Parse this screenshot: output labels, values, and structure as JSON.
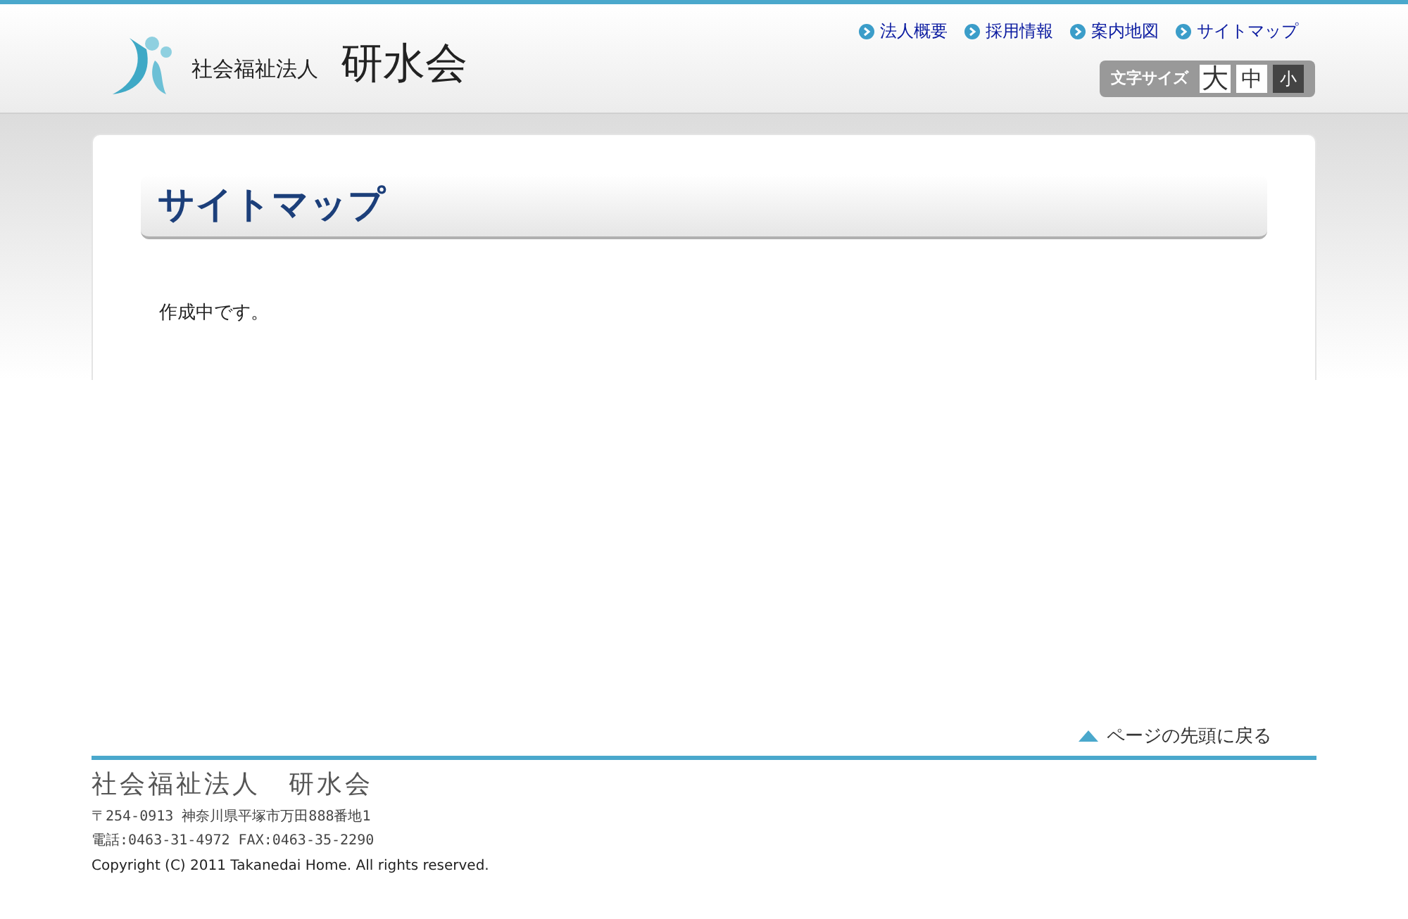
{
  "logo": {
    "subtitle": "社会福祉法人",
    "name": "研水会"
  },
  "nav": [
    {
      "label": "法人概要"
    },
    {
      "label": "採用情報"
    },
    {
      "label": "案内地図"
    },
    {
      "label": "サイトマップ"
    }
  ],
  "font_size": {
    "label": "文字サイズ",
    "options": [
      {
        "label": "大",
        "selected": false
      },
      {
        "label": "中",
        "selected": false
      },
      {
        "label": "小",
        "selected": true
      }
    ]
  },
  "page": {
    "title": "サイトマップ",
    "body": "作成中です。"
  },
  "back_to_top": "ページの先頭に戻る",
  "footer": {
    "org": "社会福祉法人　研水会",
    "address": "〒254-0913 神奈川県平塚市万田888番地1",
    "phone": "電話:0463-31-4972 FAX:0463-35-2290",
    "copyright": "Copyright (C) 2011 Takanedai Home. All rights reserved."
  }
}
